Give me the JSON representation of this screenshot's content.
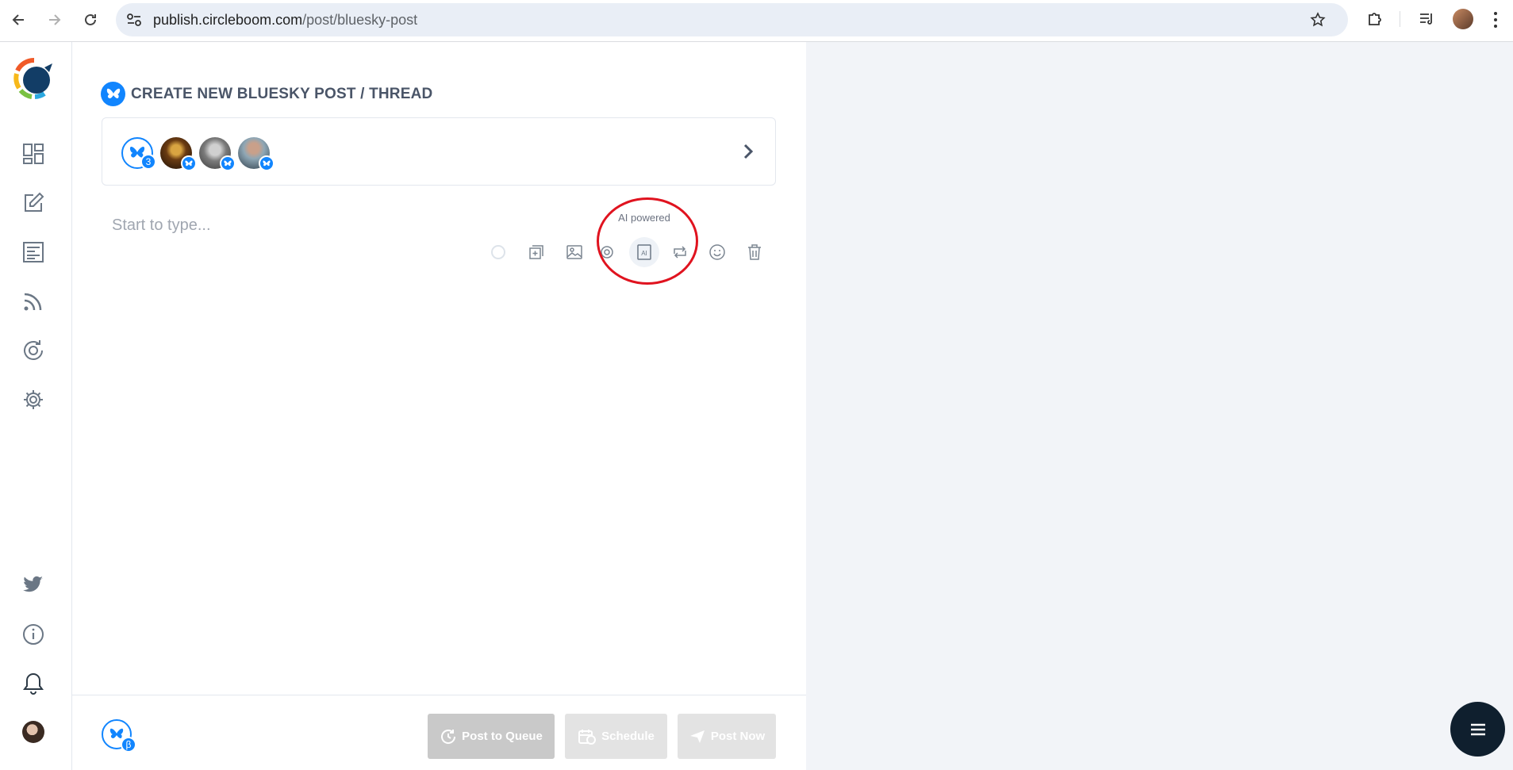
{
  "browser": {
    "url_host": "publish.circleboom.com",
    "url_path": "/post/bluesky-post"
  },
  "sidebar": {
    "items": [
      {
        "name": "dashboard-icon"
      },
      {
        "name": "compose-icon"
      },
      {
        "name": "articles-icon"
      },
      {
        "name": "rss-icon"
      },
      {
        "name": "autopost-icon"
      },
      {
        "name": "settings-icon"
      },
      {
        "name": "twitter-icon"
      },
      {
        "name": "info-icon"
      },
      {
        "name": "bell-icon"
      },
      {
        "name": "user-avatar"
      }
    ]
  },
  "header": {
    "title": "CREATE NEW BLUESKY POST / THREAD"
  },
  "accounts": {
    "selected_count": "3"
  },
  "editor": {
    "placeholder": "Start to type...",
    "tooltip": "AI powered"
  },
  "footer": {
    "platform_badge": "β",
    "post_to_queue": "Post to Queue",
    "schedule": "Schedule",
    "post_now": "Post Now"
  },
  "colors": {
    "accent": "#1185fe",
    "highlight": "#e0131f",
    "fab": "#0f1f2e"
  }
}
